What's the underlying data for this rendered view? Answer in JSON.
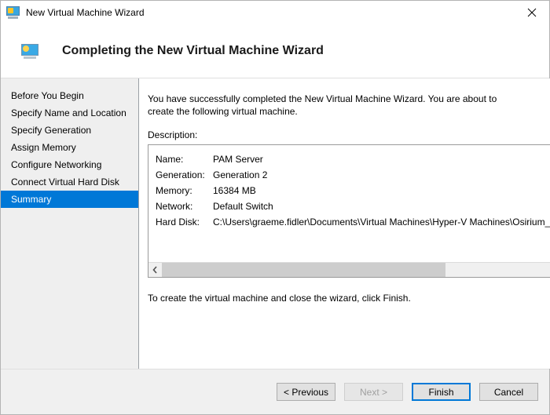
{
  "window": {
    "title": "New Virtual Machine Wizard",
    "title_icon": "virtual-machine-monitor-icon",
    "close_icon": "close-icon",
    "accent_color": "#0078d7",
    "sidebar_bg": "#efefef",
    "footer_bg": "#f0f0f0"
  },
  "header": {
    "icon": "virtual-machine-monitor-icon",
    "title": "Completing the New Virtual Machine Wizard"
  },
  "sidebar": {
    "items": [
      {
        "label": "Before You Begin",
        "selected": false
      },
      {
        "label": "Specify Name and Location",
        "selected": false
      },
      {
        "label": "Specify Generation",
        "selected": false
      },
      {
        "label": "Assign Memory",
        "selected": false
      },
      {
        "label": "Configure Networking",
        "selected": false
      },
      {
        "label": "Connect Virtual Hard Disk",
        "selected": false
      },
      {
        "label": "Summary",
        "selected": true
      }
    ]
  },
  "main": {
    "intro": "You have successfully completed the New Virtual Machine Wizard. You are about to create the following virtual machine.",
    "description_label": "Description:",
    "summary_rows": [
      {
        "key": "Name:",
        "value": "PAM Server"
      },
      {
        "key": "Generation:",
        "value": "Generation 2"
      },
      {
        "key": "Memory:",
        "value": "16384 MB"
      },
      {
        "key": "Network:",
        "value": "Default Switch"
      },
      {
        "key": "Hard Disk:",
        "value": "C:\\Users\\graeme.fidler\\Documents\\Virtual Machines\\Hyper-V Machines\\Osirium_PAM_Server.vhdx"
      }
    ],
    "scrollbar": {
      "left_arrow_icon": "chevron-left-icon",
      "right_arrow_icon": "chevron-right-icon",
      "thumb_fraction_percent": 63
    },
    "closing_note": "To create the virtual machine and close the wizard, click Finish."
  },
  "footer": {
    "buttons": [
      {
        "label": "< Previous",
        "state": "enabled",
        "name": "previous-button"
      },
      {
        "label": "Next >",
        "state": "disabled",
        "name": "next-button"
      },
      {
        "label": "Finish",
        "state": "default",
        "name": "finish-button"
      },
      {
        "label": "Cancel",
        "state": "enabled",
        "name": "cancel-button"
      }
    ]
  }
}
